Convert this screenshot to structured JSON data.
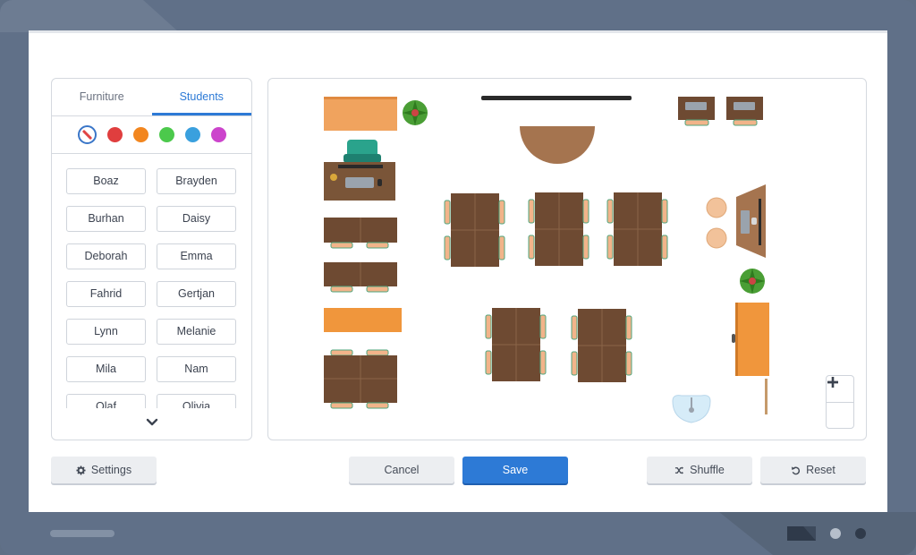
{
  "tabs": [
    {
      "label": "Furniture",
      "active": false
    },
    {
      "label": "Students",
      "active": true
    }
  ],
  "colors": [
    "#e03e3e",
    "#f2861f",
    "#4cc94c",
    "#3aa0de",
    "#cc44cc"
  ],
  "students": [
    "Boaz",
    "Brayden",
    "Burhan",
    "Daisy",
    "Deborah",
    "Emma",
    "Fahrid",
    "Gertjan",
    "Lynn",
    "Melanie",
    "Mila",
    "Nam",
    "Olaf",
    "Olivia"
  ],
  "buttons": {
    "settings": "Settings",
    "cancel": "Cancel",
    "save": "Save",
    "shuffle": "Shuffle",
    "reset": "Reset"
  },
  "icons": {
    "settings": "gear-icon",
    "shuffle": "shuffle-icon",
    "reset": "undo-icon",
    "scroll": "chevron-down-icon",
    "zoom_in": "plus-icon",
    "zoom_out": "minus-icon",
    "eraser": "no-color-icon"
  },
  "palette": {
    "accent": "#2d7ad6",
    "table": "#6e4a32",
    "cabinet": "#f09a50",
    "teacher_table": "#a5744f",
    "plant": "#4a9e35"
  }
}
